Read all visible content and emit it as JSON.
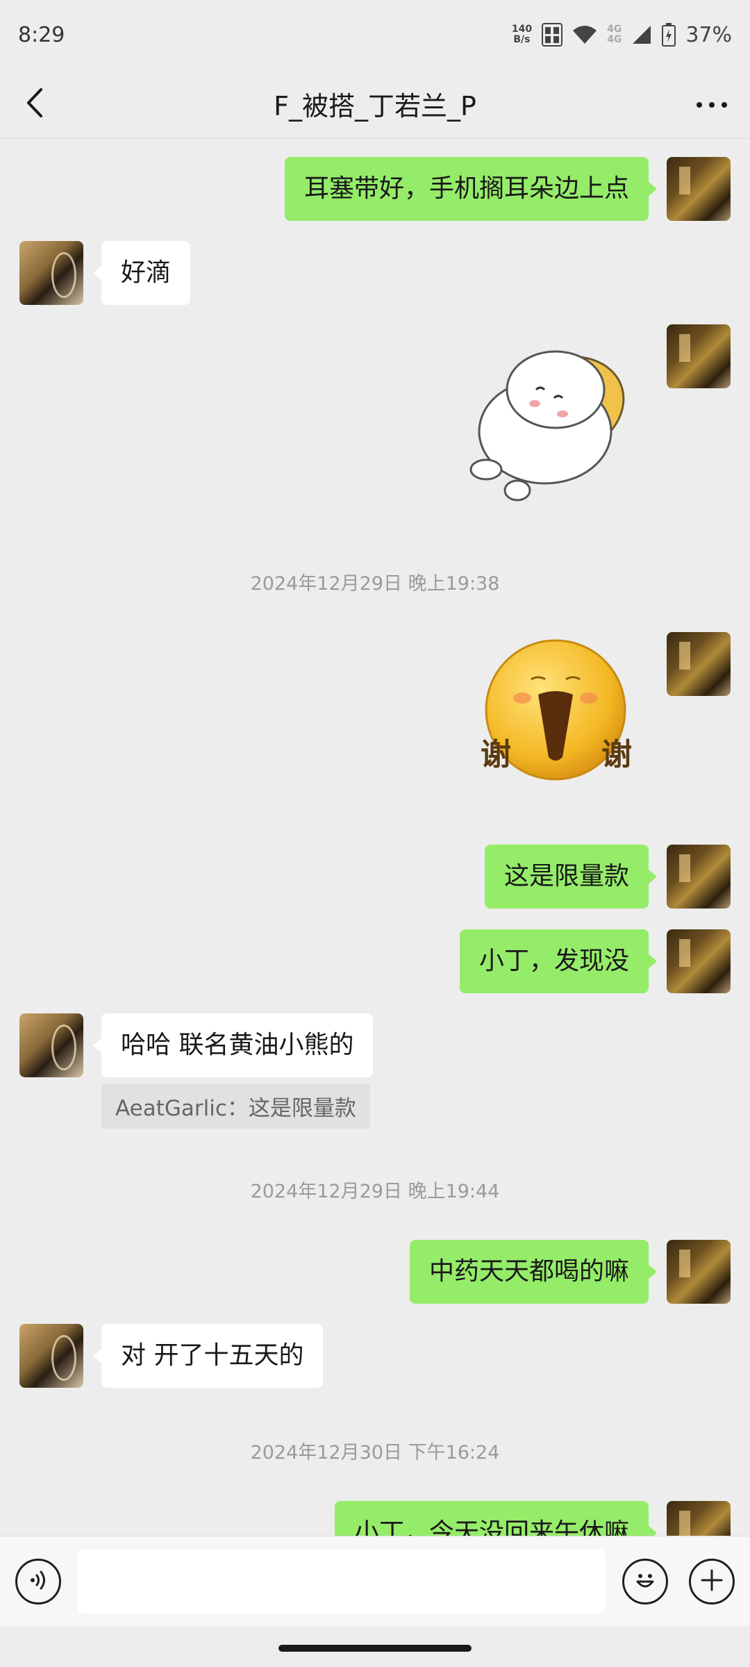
{
  "status": {
    "time": "8:29",
    "speed_value": "140",
    "speed_unit": "B/s",
    "net1": "4G",
    "net2": "4G",
    "battery": "37%"
  },
  "nav": {
    "title": "F_被搭_丁若兰_P"
  },
  "messages": {
    "m1": "耳塞带好，手机搁耳朵边上点",
    "m2": "好滴",
    "ts1": "2024年12月29日 晚上19:38",
    "thanks_left": "谢",
    "thanks_right": "谢",
    "m3": "这是限量款",
    "m4": "小丁，发现没",
    "m5": "哈哈 联名黄油小熊的",
    "quote": "AeatGarlic：这是限量款",
    "ts2": "2024年12月29日 晚上19:44",
    "m6": "中药天天都喝的嘛",
    "m7": "对 开了十五天的",
    "ts3": "2024年12月30日 下午16:24",
    "m8": "小丁，今天没回来午休嘛"
  },
  "input": {
    "placeholder": ""
  },
  "colors": {
    "my_bubble": "#95ec69",
    "other_bubble": "#ffffff",
    "background": "#ededed"
  }
}
